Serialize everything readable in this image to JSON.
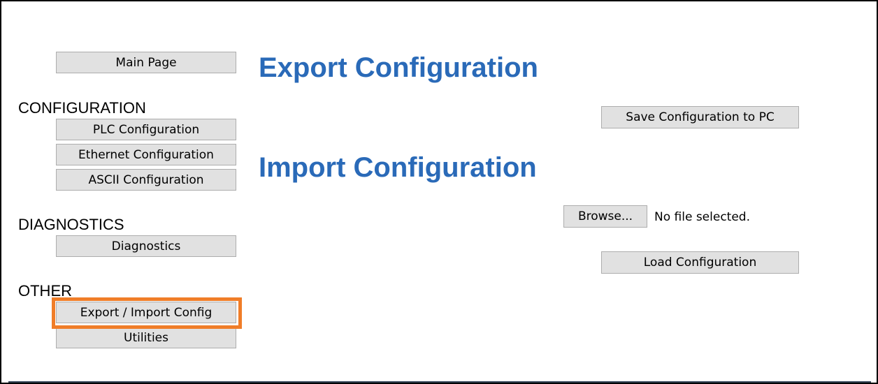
{
  "nav": {
    "main_page": "Main Page",
    "configuration": {
      "label": "CONFIGURATION",
      "items": [
        "PLC Configuration",
        "Ethernet Configuration",
        "ASCII Configuration"
      ]
    },
    "diagnostics": {
      "label": "DIAGNOSTICS",
      "items": [
        "Diagnostics"
      ]
    },
    "other": {
      "label": "OTHER",
      "items": [
        "Export / Import Config",
        "Utilities"
      ]
    }
  },
  "export": {
    "title": "Export Configuration",
    "save_label": "Save Configuration to PC"
  },
  "import": {
    "title": "Import Configuration",
    "browse_label": "Browse...",
    "file_status": "No file selected.",
    "load_label": "Load Configuration"
  },
  "colors": {
    "heading": "#2a6ab8",
    "highlight": "#f07d28",
    "button_bg": "#e1e1e1"
  }
}
